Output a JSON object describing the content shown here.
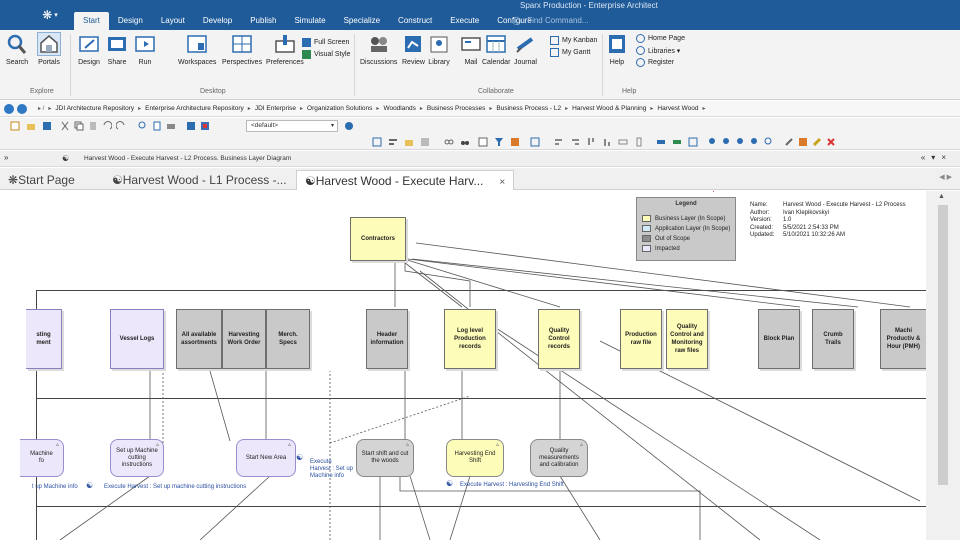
{
  "window": {
    "title": "Sparx Production - Enterprise Architect",
    "find_placeholder": "Find Command..."
  },
  "ribbon_tabs": [
    {
      "label": "Start",
      "active": true
    },
    {
      "label": "Design"
    },
    {
      "label": "Layout"
    },
    {
      "label": "Develop"
    },
    {
      "label": "Publish"
    },
    {
      "label": "Simulate"
    },
    {
      "label": "Specialize"
    },
    {
      "label": "Construct"
    },
    {
      "label": "Execute"
    },
    {
      "label": "Configure"
    }
  ],
  "ribbon": {
    "explore": {
      "label": "Explore",
      "search": "Search",
      "portals": "Portals"
    },
    "desktop": {
      "label": "Desktop",
      "design": "Design",
      "share": "Share",
      "run": "Run",
      "workspaces": "Workspaces",
      "perspectives": "Perspectives",
      "preferences": "Preferences",
      "full_screen": "Full Screen",
      "visual_style": "Visual Style"
    },
    "collaborate": {
      "label": "Collaborate",
      "discussions": "Discussions",
      "review": "Review",
      "library": "Library",
      "mail": "Mail",
      "calendar": "Calendar",
      "journal": "Journal",
      "my_kanban": "My Kanban",
      "my_gantt": "My Gantt"
    },
    "help": {
      "label": "Help",
      "help": "Help",
      "home_page": "Home Page",
      "libraries": "Libraries ▾",
      "register": "Register"
    }
  },
  "breadcrumb": [
    "JDI Architecture Repository",
    "Enterprise Architecture Repository",
    "JDI Enterprise",
    "Organization Solutions",
    "Woodlands",
    "Business Processes",
    "Business Process - L2",
    "Harvest Wood & Planning",
    "Harvest Wood"
  ],
  "toolbar": {
    "style_select": "<default>"
  },
  "diagram_bar": {
    "caption": "Harvest Wood - Execute Harvest - L2 Process.  Business Layer Diagram"
  },
  "doc_tabs": [
    {
      "label": "Start Page"
    },
    {
      "label": "Harvest Wood - L1 Process -..."
    },
    {
      "label": "Harvest Wood - Execute Harv...",
      "active": true,
      "close": "×"
    }
  ],
  "diagram": {
    "contractors": "Contractors",
    "row1": [
      {
        "label": "sting\nment",
        "style": "lav"
      },
      {
        "label": "Vessel Logs",
        "style": "lav"
      },
      {
        "label": "All available assortments",
        "style": "gray"
      },
      {
        "label": "Harvesting Work Order",
        "style": "gray"
      },
      {
        "label": "Merch. Specs",
        "style": "gray"
      },
      {
        "label": "Header information",
        "style": "gray"
      },
      {
        "label": "Log level Production records",
        "style": "yellow"
      },
      {
        "label": "Quality Control records",
        "style": "yellow"
      },
      {
        "label": "Production raw file",
        "style": "yellow"
      },
      {
        "label": "Quality Control and Monitoring raw files",
        "style": "yellow"
      },
      {
        "label": "Block Plan",
        "style": "gray"
      },
      {
        "label": "Crumb Trails",
        "style": "gray"
      },
      {
        "label": "Machi Productiv & Hour (PMH)",
        "style": "gray"
      }
    ],
    "activities": [
      {
        "label": "Machine\nfo",
        "style": "lav"
      },
      {
        "label": "Set up Machine cutting instructions",
        "style": "lav"
      },
      {
        "label": "Start New Area",
        "style": "lav"
      },
      {
        "label": "Start shift and cut the woods",
        "style": "gray"
      },
      {
        "label": "Harvesting End Shift",
        "style": "yellow"
      },
      {
        "label": "Quality measurements and calibration",
        "style": "gray"
      }
    ],
    "sub_labels": {
      "setup_info": "t up Machine info",
      "setup_cutting": "Execute Harvest : Set up machine cutting instructions",
      "setup_machine_info": "Execute Harvest : Set up Machine info",
      "end_shift": "Execute Harvest : Harvesting End Shift"
    },
    "legend": {
      "title": "Legend",
      "items": [
        {
          "label": "Business Layer (In Scope)",
          "color": "#fdfcb8"
        },
        {
          "label": "Application Layer (In Scope)",
          "color": "#cfe9f7"
        },
        {
          "label": "Out of Scope",
          "color": "#8d8d8d"
        },
        {
          "label": "Impacted",
          "color": "#ece7fa"
        }
      ]
    },
    "info": {
      "name_k": "Name:",
      "name_v": "Harvest Wood - Execute Harvest - L2 Process",
      "author_k": "Author:",
      "author_v": "Ivan Klepikovskyi",
      "version_k": "Version:",
      "version_v": "1.0",
      "created_k": "Created:",
      "created_v": "5/5/2021 2:54:33 PM",
      "updated_k": "Updated:",
      "updated_v": "5/10/2021 10:32:26 AM"
    }
  }
}
